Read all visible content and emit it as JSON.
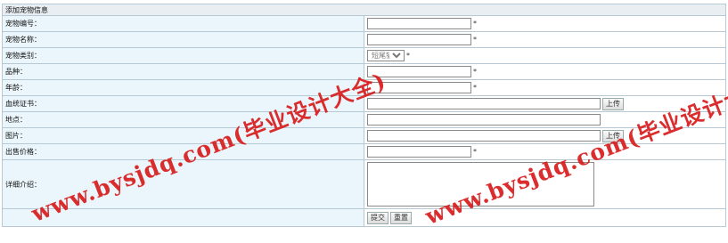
{
  "form": {
    "title": "添加宠物信息",
    "submit_label": "提交",
    "reset_label": "重置",
    "upload_label": "上传",
    "required_mark": "*",
    "fields": {
      "id": {
        "label": "宠物编号：",
        "value": ""
      },
      "name": {
        "label": "宠物名称：",
        "value": ""
      },
      "category": {
        "label": "宠物类别：",
        "selected": "短尾猫"
      },
      "breed": {
        "label": "品种：",
        "value": ""
      },
      "age": {
        "label": "年龄：",
        "value": ""
      },
      "pedigree": {
        "label": "血统证书：",
        "value": ""
      },
      "location": {
        "label": "地点：",
        "value": ""
      },
      "image": {
        "label": "图片：",
        "value": ""
      },
      "price": {
        "label": "出售价格：",
        "value": ""
      },
      "description": {
        "label": "详细介绍：",
        "value": ""
      }
    }
  },
  "watermark": {
    "text": "www.bysjdq.com(毕业设计大全)",
    "text_partial": "www.bysjdq.com(毕业设计大",
    "color": "#d81c1c"
  }
}
